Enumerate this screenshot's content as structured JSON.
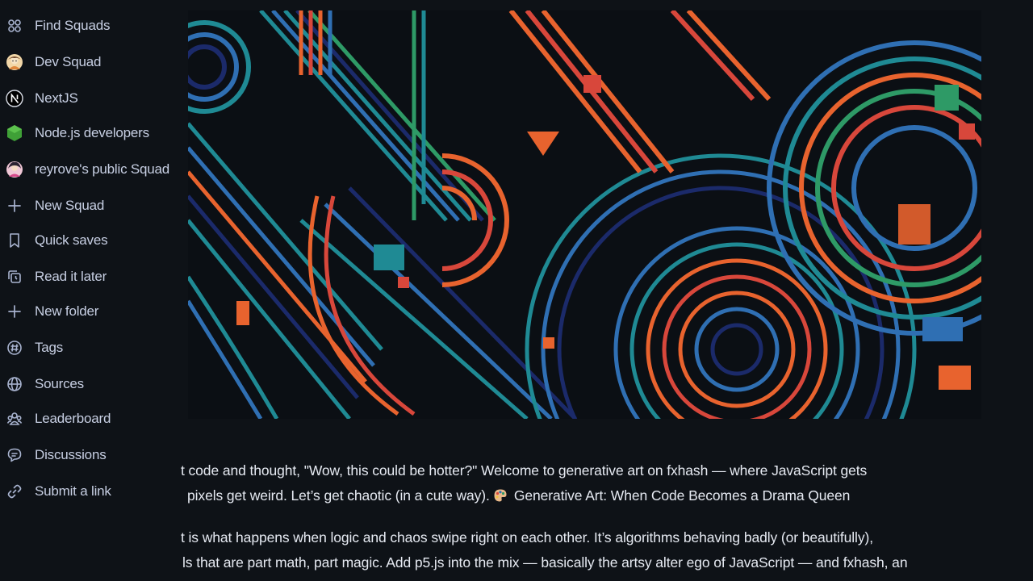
{
  "sidebar": {
    "items": [
      {
        "label": "Find Squads",
        "icon": "squads-icon"
      },
      {
        "label": "Dev Squad",
        "icon": "dev-squad-avatar-icon"
      },
      {
        "label": "NextJS",
        "icon": "nextjs-logo-icon"
      },
      {
        "label": "Node.js developers",
        "icon": "nodejs-logo-icon"
      },
      {
        "label": "reyrove's public Squad",
        "icon": "user-avatar-icon"
      },
      {
        "label": "New Squad",
        "icon": "plus-icon"
      },
      {
        "label": "Quick saves",
        "icon": "bookmark-icon"
      },
      {
        "label": "Read it later",
        "icon": "read-later-icon"
      },
      {
        "label": "New folder",
        "icon": "plus-icon"
      },
      {
        "label": "Tags",
        "icon": "hashtag-icon"
      },
      {
        "label": "Sources",
        "icon": "globe-icon"
      },
      {
        "label": "Leaderboard",
        "icon": "leaderboard-icon"
      },
      {
        "label": "Discussions",
        "icon": "discussions-icon"
      },
      {
        "label": "Submit a link",
        "icon": "link-icon"
      }
    ]
  },
  "article": {
    "para1": {
      "line1": "t code and thought, \"Wow, this could be hotter?\" Welcome to generative art on fxhash — where JavaScript gets",
      "line2a": "pixels get weird. Let’s get chaotic (in a cute way).",
      "line2b": "Generative Art: When Code Becomes a Drama Queen"
    },
    "para2": {
      "line1": "t is what happens when logic and chaos swipe right on each other. It’s algorithms behaving badly (or beautifully),",
      "line2": "ls that are part math, part magic. Add p5.js into the mix — basically the artsy alter ego of JavaScript — and fxhash, an"
    },
    "emoji_icon": "artist-palette-icon"
  },
  "colors": {
    "background": "#0e1217",
    "text": "#e6eaf2",
    "sidebar_text": "#c7cfe3",
    "icon": "#a8b3cf",
    "art_teal": "#1f8a94",
    "art_blue": "#2f6fb3",
    "art_orange": "#e8632e",
    "art_red": "#d8473b",
    "art_green": "#2e9a66",
    "art_navy": "#1b2a6a"
  }
}
